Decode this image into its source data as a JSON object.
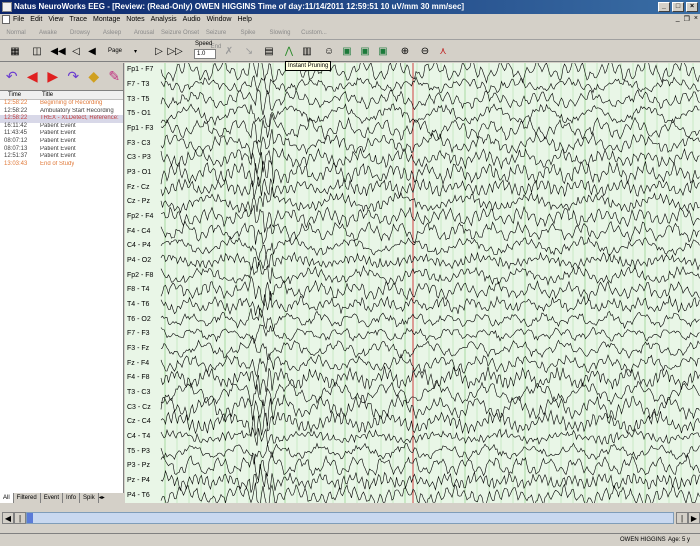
{
  "window": {
    "title": "Natus NeuroWorks EEG - [Review: (Read-Only)      OWEN HIGGINS    Time of day:11/14/2011 12:59:51   10 uV/mm   30 mm/sec]"
  },
  "menu": [
    "File",
    "Edit",
    "View",
    "Trace",
    "Montage",
    "Notes",
    "Analysis",
    "Audio",
    "Window",
    "Help"
  ],
  "modes": [
    "Normal",
    "Awake",
    "Drowsy",
    "Asleep",
    "Arousal",
    "Seizure Onset",
    "Seizure End",
    "Spike",
    "Slowing",
    "Custom..."
  ],
  "toolbar": {
    "page_label": "Page",
    "speed_label": "Speed",
    "speed_value": "1.0",
    "tooltip": "Instant Pruning"
  },
  "events": {
    "col_time": "Time",
    "col_title": "Title",
    "rows": [
      {
        "time": "12:58:22",
        "title": "Beginning of Recording",
        "color": "#e07a3a"
      },
      {
        "time": "12:58:22",
        "title": "Ambulatory Start Recording",
        "color": "#404040"
      },
      {
        "time": "12:58:22",
        "title": "TREX - XLDetect, Reference:",
        "color": "#c04040"
      },
      {
        "time": "16:11:42",
        "title": "Patient Event",
        "color": "#404040"
      },
      {
        "time": "11:43:45",
        "title": "Patient Event",
        "color": "#404040"
      },
      {
        "time": "08:07:12",
        "title": "Patient Event",
        "color": "#404040"
      },
      {
        "time": "08:07:13",
        "title": "Patient Event",
        "color": "#404040"
      },
      {
        "time": "12:51:37",
        "title": "Patient Event",
        "color": "#404040"
      },
      {
        "time": "13:03:43",
        "title": "End of Study",
        "color": "#e07a3a"
      }
    ]
  },
  "side_tabs": [
    "All",
    "Filtered",
    "Event",
    "Info",
    "Spik"
  ],
  "channels": [
    "Fp1 - F7",
    "F7 - T3",
    "T3 - T5",
    "T5 - O1",
    "Fp1 - F3",
    "F3 - C3",
    "C3 - P3",
    "P3 - O1",
    "Fz - Cz",
    "Cz - Pz",
    "Fp2 - F4",
    "F4 - C4",
    "C4 - P4",
    "P4 - O2",
    "Fp2 - F8",
    "F8 - T4",
    "T4 - T6",
    "T6 - O2",
    "F7 - F3",
    "F3 - Fz",
    "Fz - F4",
    "F4 - F8",
    "T3 - C3",
    "C3 - Cz",
    "Cz - C4",
    "C4 - T4",
    "T5 - P3",
    "P3 - Pz",
    "Pz - P4",
    "P4 - T6"
  ],
  "status": {
    "patient": "OWEN HIGGINS",
    "age": "Age: 5 y"
  },
  "colors": {
    "eeg_bg": "#e9f6e7",
    "grid": "#a8dba0",
    "marker": "#d04040",
    "trace": "#000000"
  }
}
